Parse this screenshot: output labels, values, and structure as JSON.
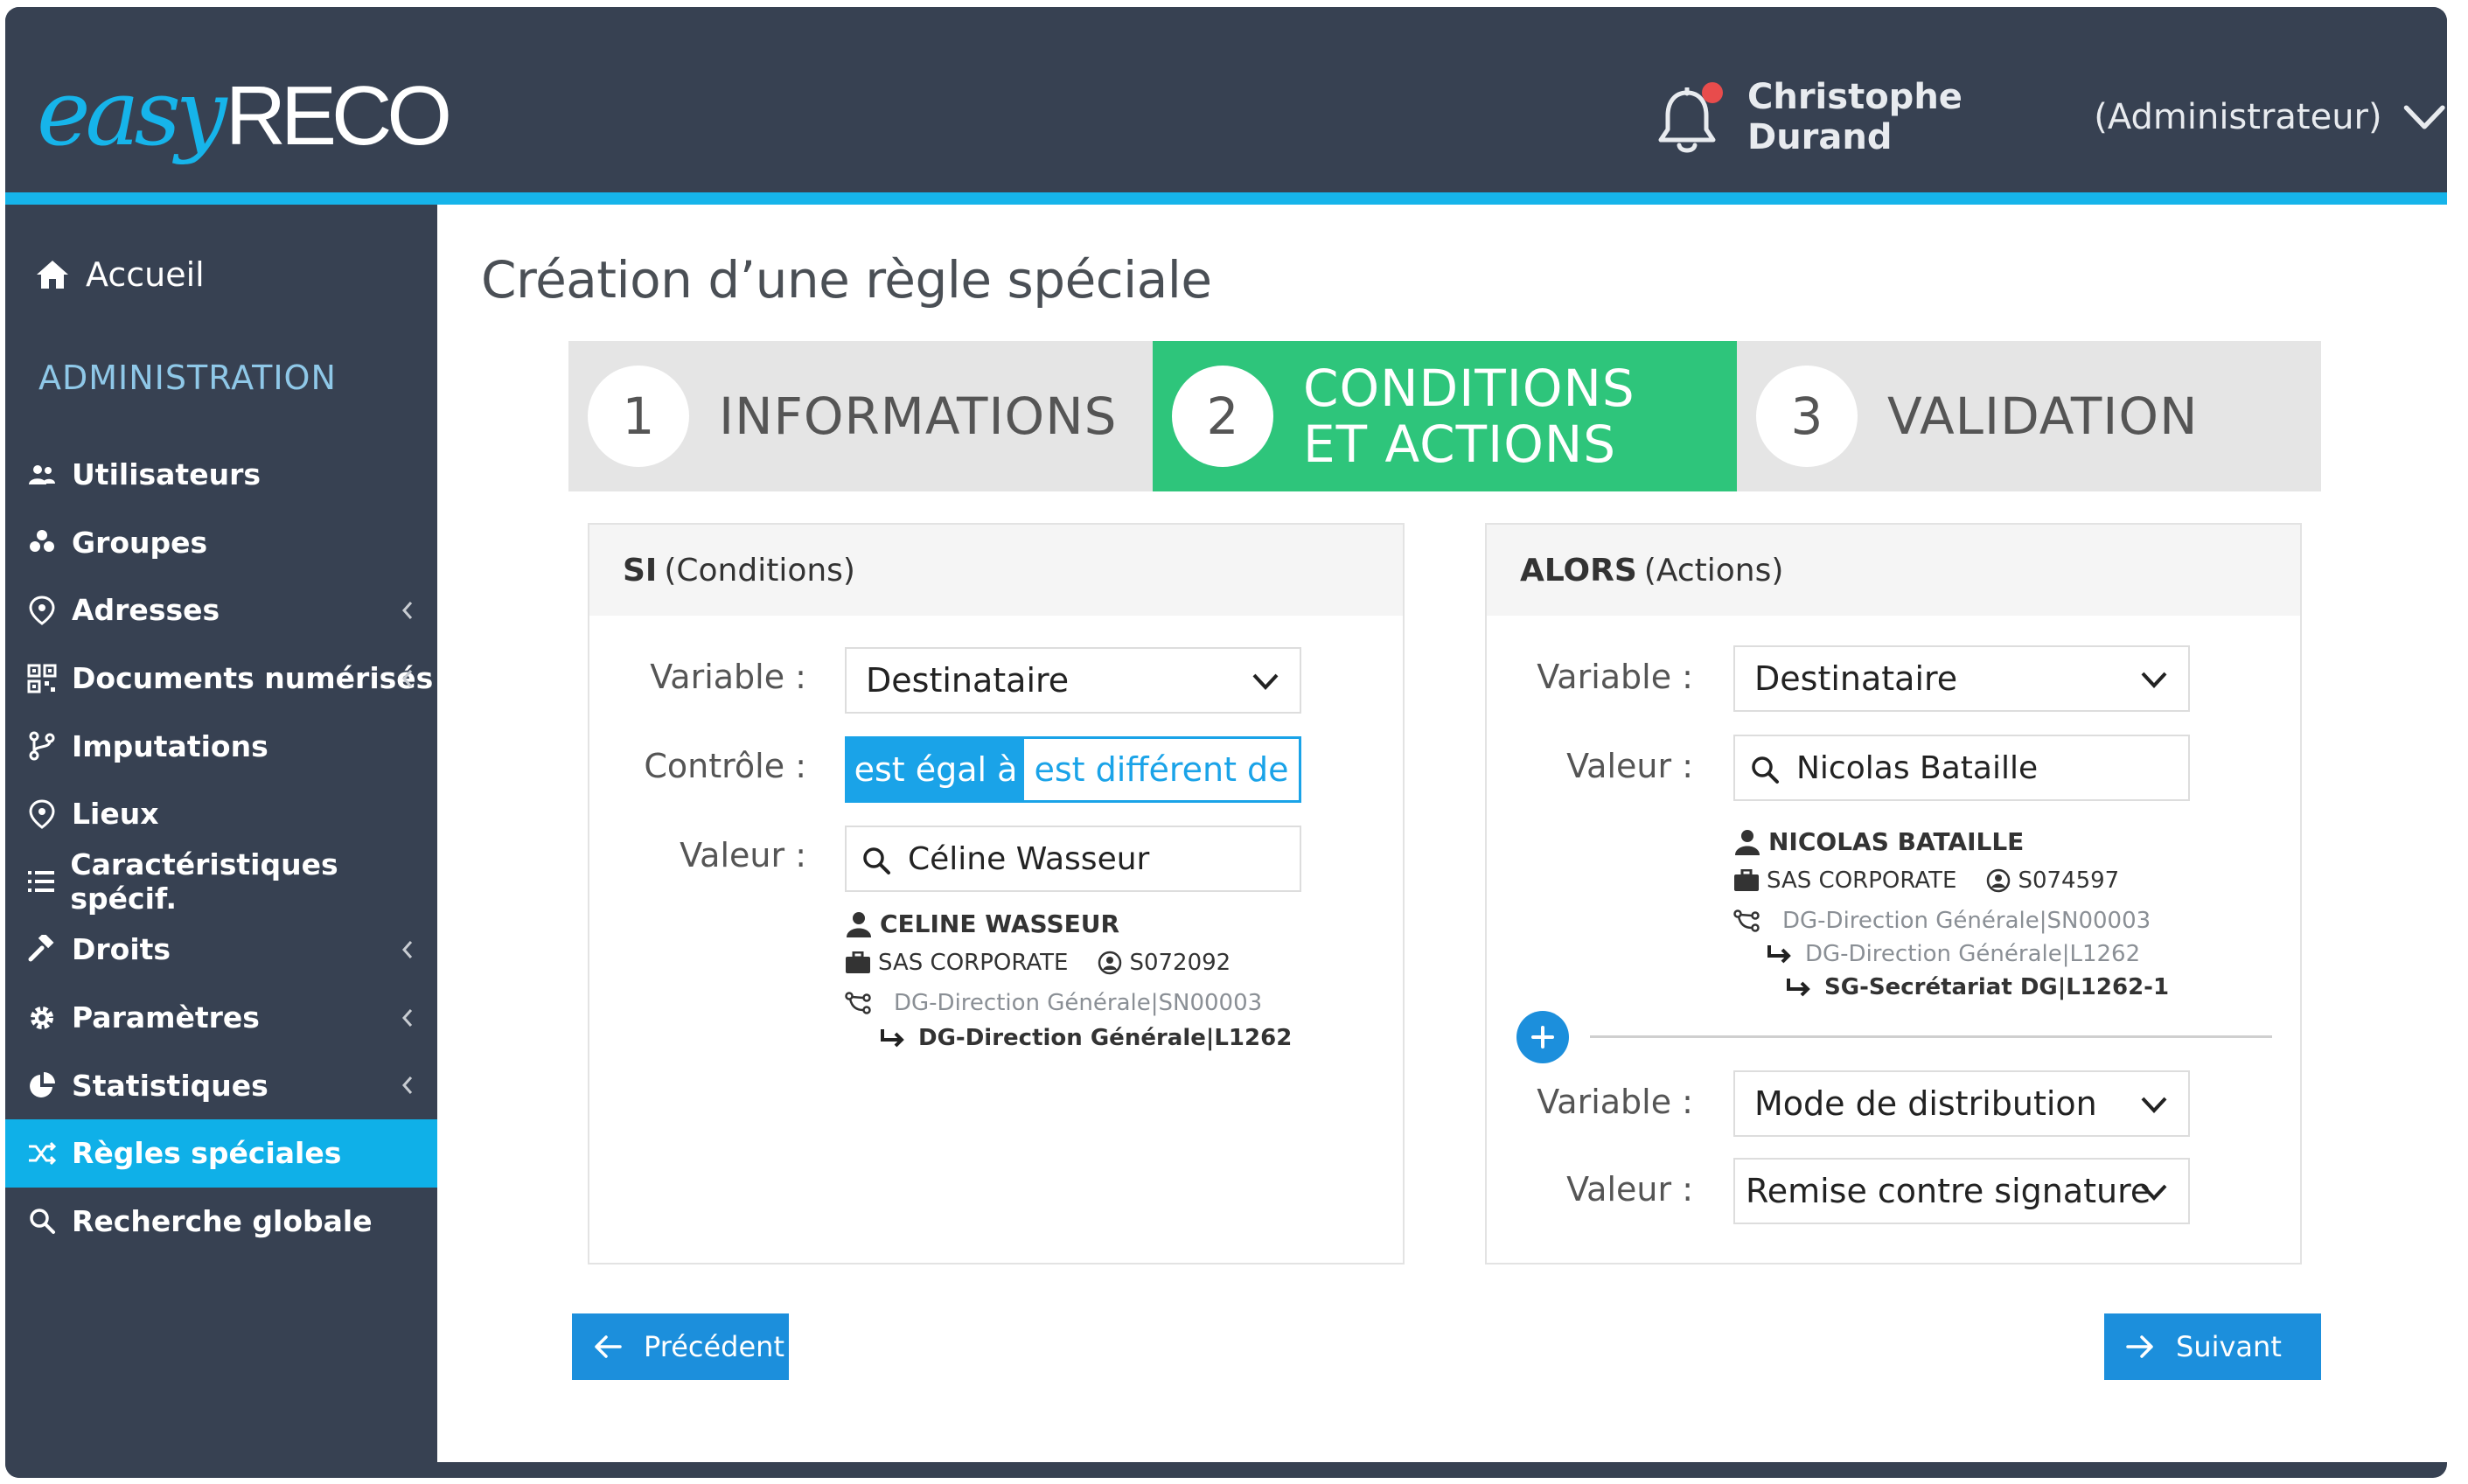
{
  "header": {
    "logo_easy": "easy",
    "logo_reco": "RECO",
    "user_name": "Christophe Durand",
    "user_role": "(Administrateur)"
  },
  "sidebar": {
    "home_label": "Accueil",
    "section_title": "ADMINISTRATION",
    "items": [
      {
        "label": "Utilisateurs",
        "icon": "users-icon",
        "chevron": false,
        "active": false
      },
      {
        "label": "Groupes",
        "icon": "groups-icon",
        "chevron": false,
        "active": false
      },
      {
        "label": "Adresses",
        "icon": "map-pin-icon",
        "chevron": true,
        "active": false
      },
      {
        "label": "Documents numérisés",
        "icon": "qrcode-icon",
        "chevron": true,
        "active": false
      },
      {
        "label": "Imputations",
        "icon": "branch-icon",
        "chevron": false,
        "active": false
      },
      {
        "label": "Lieux",
        "icon": "map-pin-icon",
        "chevron": false,
        "active": false
      },
      {
        "label": "Caractéristiques spécif.",
        "icon": "list-icon",
        "chevron": false,
        "active": false
      },
      {
        "label": "Droits",
        "icon": "gavel-icon",
        "chevron": true,
        "active": false
      },
      {
        "label": "Paramètres",
        "icon": "gear-icon",
        "chevron": true,
        "active": false
      },
      {
        "label": "Statistiques",
        "icon": "pie-chart-icon",
        "chevron": true,
        "active": false
      },
      {
        "label": "Règles spéciales",
        "icon": "shuffle-icon",
        "chevron": false,
        "active": true
      },
      {
        "label": "Recherche globale",
        "icon": "search-icon",
        "chevron": false,
        "active": false
      }
    ]
  },
  "page": {
    "title": "Création d’une règle spéciale"
  },
  "steps": [
    {
      "num": "1",
      "label": "INFORMATIONS",
      "active": false
    },
    {
      "num": "2",
      "label": "CONDITIONS\nET ACTIONS",
      "active": true
    },
    {
      "num": "3",
      "label": "VALIDATION",
      "active": false
    }
  ],
  "conditions": {
    "head_bold": "SI",
    "head_rest": "(Conditions)",
    "variable_label": "Variable :",
    "variable_value": "Destinataire",
    "control_label": "Contrôle :",
    "control_on": "est égal à",
    "control_off": "est différent de",
    "value_label": "Valeur :",
    "value_input": "Céline Wasseur",
    "person": {
      "name": "CELINE WASSEUR",
      "company": "SAS CORPORATE",
      "id": "S072092",
      "path1": "DG-Direction Générale|SN00003",
      "path2": "DG-Direction Générale|L1262"
    }
  },
  "actions": {
    "head_bold": "ALORS",
    "head_rest": "(Actions)",
    "variable_label": "Variable :",
    "variable_value": "Destinataire",
    "value_label": "Valeur :",
    "value_input": "Nicolas Bataille",
    "person": {
      "name": "NICOLAS BATAILLE",
      "company": "SAS CORPORATE",
      "id": "S074597",
      "path1": "DG-Direction Générale|SN00003",
      "path2": "DG-Direction Générale|L1262",
      "path3": "SG-Secrétariat DG|L1262-1"
    },
    "variable2_label": "Variable :",
    "variable2_value": "Mode de distribution",
    "value2_label": "Valeur :",
    "value2_value": "Remise contre signature"
  },
  "footer": {
    "prev_label": "Précédent",
    "next_label": "Suivant"
  },
  "colors": {
    "header_bg": "#374152",
    "accent": "#16b4ea",
    "step_active": "#2ec57b",
    "button": "#1c8fdc"
  }
}
